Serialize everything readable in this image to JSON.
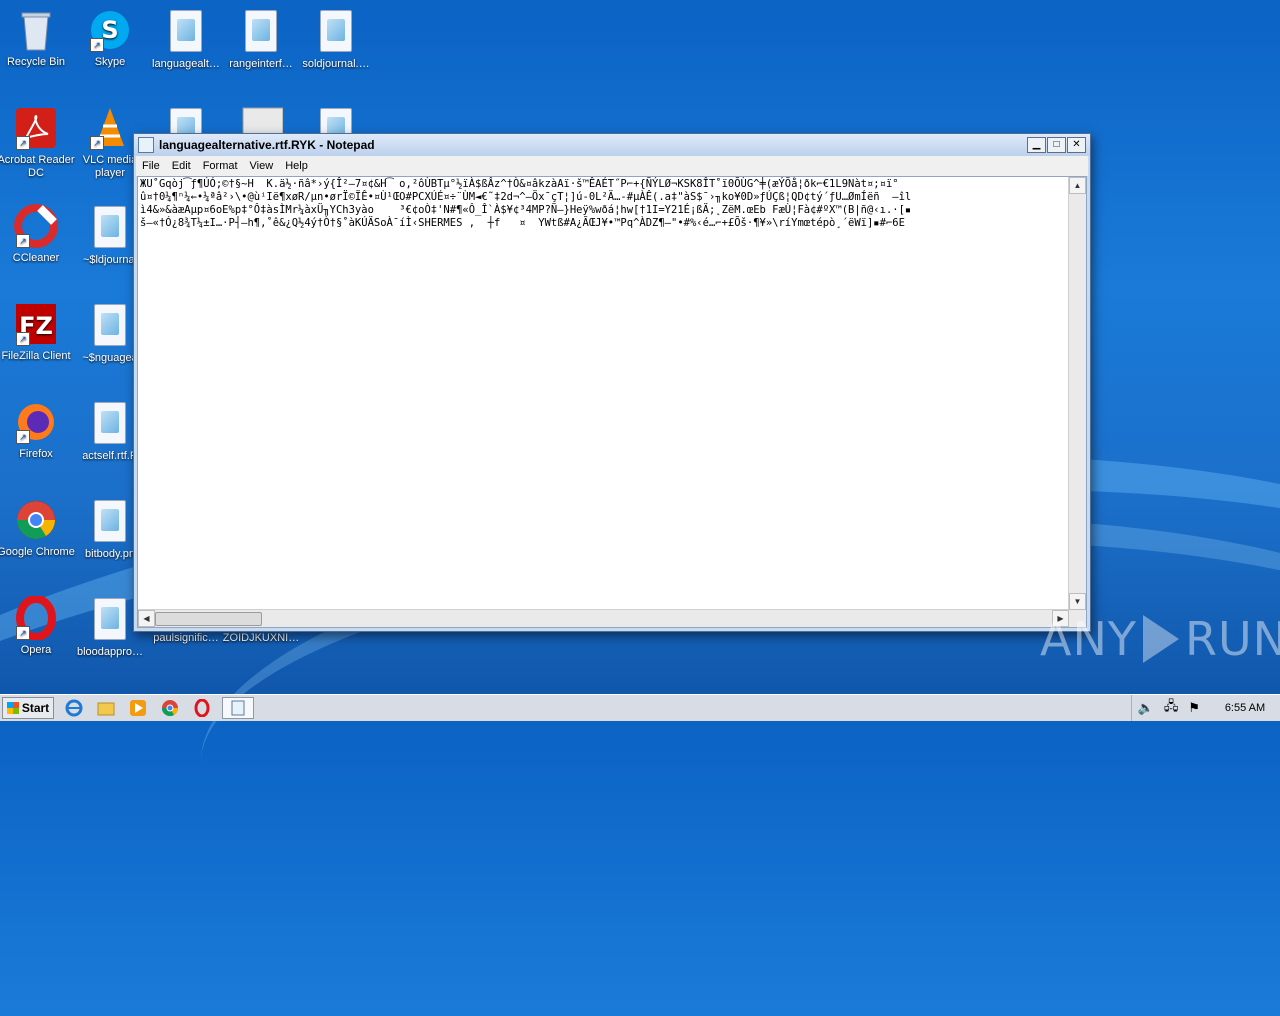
{
  "desktop": {
    "icons": [
      {
        "label": "Recycle Bin",
        "glyph": "recycle-bin-icon"
      },
      {
        "label": "Skype",
        "glyph": "skype-icon"
      },
      {
        "label": "languagealt…",
        "glyph": "document-icon"
      },
      {
        "label": "rangeinterf…",
        "glyph": "document-icon"
      },
      {
        "label": "soldjournal.…",
        "glyph": "document-icon"
      },
      {
        "label": "Acrobat Reader DC",
        "glyph": "acrobat-icon"
      },
      {
        "label": "VLC media player",
        "glyph": "vlc-icon"
      },
      {
        "label": "CCleaner",
        "glyph": "ccleaner-icon"
      },
      {
        "label": "~$ldjournal",
        "glyph": "document-icon"
      },
      {
        "label": "FileZilla Client",
        "glyph": "filezilla-icon"
      },
      {
        "label": "~$nguagea",
        "glyph": "document-icon"
      },
      {
        "label": "Firefox",
        "glyph": "firefox-icon"
      },
      {
        "label": "actself.rtf.R",
        "glyph": "document-icon"
      },
      {
        "label": "Google Chrome",
        "glyph": "chrome-icon"
      },
      {
        "label": "bitbody.pn",
        "glyph": "document-icon"
      },
      {
        "label": "Opera",
        "glyph": "opera-icon"
      },
      {
        "label": "bloodappro…",
        "glyph": "document-icon"
      },
      {
        "label": "paulsignific…",
        "glyph": "document-icon"
      },
      {
        "label": "ZOIDJKUXNI…",
        "glyph": "document-icon"
      }
    ]
  },
  "notepad": {
    "title": "languagealternative.rtf.RYK - Notepad",
    "menu": [
      "File",
      "Edit",
      "Format",
      "View",
      "Help"
    ],
    "content_lines": [
      "ЖU˚Gqòj͡ƒ¶ÚÓ;©†§~H  K.ä½·ñâ*›ý{Î²—7¤¢&H͡ o,²ôÙBTµ°½ïÀ$ßÂz^†Ò&¤âkzàAï·š™ÊAÉT˝P⌐+{ÑÝLØ¬KSK8ÎT˚ï0ÕÙG^╪(æÝÕå¦ðk⌐€1L9Nàt¤;¤ï°",
      "û¤†0¼¶ⁿ¼←•¼ªâ²›\\•@ùⁱIë¶xøR/µn•ørÏ©ÏÊ•¤Ù¹ŒO#PCXÚÉ¤÷¨ÙM◄€˜‡2d¬^–Öx¯çT¦]ú-0L²Ä…-#µÀÊ(.a‡\"àS$¯›╖ko¥0D»ƒÚÇß¦QD¢tý´ƒU…ØmÍëñ  —îl",
      "ì4&»&àæAµp¤6oE%p‡°Ô‡àsÌMr¼àxÜ╖YCh3yào    ³€¢oÒ‡'N#¶«Ô_Î`À$¥¢³4MP?Ñ—}Heÿ%wðá¦hw[†1I=Y21É¡ßÄ;˛ZëM.œEb FæÙ¦Fà¢#ºX™(B|ñ@‹ı.·[▪",
      "š—«†Ó¿8¾T¼±I…·P┤—h¶,˚ê&¿Q½4ý†Ò†§˚àKÚÄSoÀ¯íÌ‹SHERMES ,  ┼f   ¤  YWtß#A¿ÃŒJ¥•™Pq^ÀDZ¶—\"•#%‹é…⌐+£Õš·¶¥»\\ríYmœtépò¸´ëWï]▪#⌐6E"
    ]
  },
  "taskbar": {
    "start_label": "Start",
    "clock": "6:55 AM",
    "pinned": [
      "ie-icon",
      "explorer-icon",
      "media-player-icon",
      "chrome-icon",
      "opera-icon",
      "notepad-icon"
    ]
  },
  "watermark": {
    "text_left": "ANY",
    "text_right": "RUN"
  }
}
